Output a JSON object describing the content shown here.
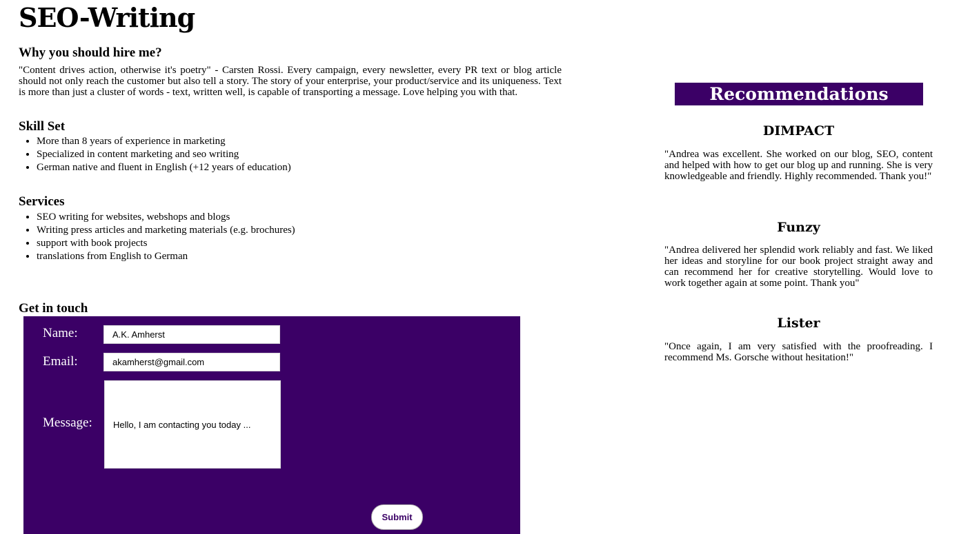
{
  "header": {
    "title": "SEO-Writing"
  },
  "hire": {
    "heading": "Why you should hire me?",
    "text": "\"Content drives action, otherwise it's poetry\" - Carsten Rossi. Every campaign, every newsletter, every PR text or blog article should not only reach the customer but also tell a story. The story of your enterprise, your product/service and its uniqueness. Text is more than just a cluster of words - text, written well, is capable of transporting a message. Love helping you with that."
  },
  "skills": {
    "heading": "Skill Set",
    "items": [
      "More than 8 years of experience in marketing",
      "Specialized in content marketing and seo writing",
      "German native and fluent in English (+12 years of education)"
    ]
  },
  "services": {
    "heading": "Services",
    "items": [
      "SEO writing for websites, webshops and blogs",
      "Writing press articles and marketing materials (e.g. brochures)",
      "support with book projects",
      "translations from English to German"
    ]
  },
  "contact": {
    "heading": "Get in touch",
    "name_label": "Name:",
    "name_value": "A.K. Amherst",
    "email_label": "Email:",
    "email_value": "akamherst@gmail.com",
    "message_label": "Message:",
    "message_value": "Hello, I am contacting you today ...",
    "submit_label": "Submit"
  },
  "recommendations": {
    "heading": "Recommendations",
    "items": [
      {
        "name": "DIMPACT",
        "text": "\"Andrea was excellent. She worked on our blog, SEO, content and helped with how to get our blog up and running. She is very knowledgeable and friendly. Highly recommended. Thank you!\""
      },
      {
        "name": "Funzy",
        "text": "\"Andrea delivered her splendid work reliably and fast. We liked her ideas and storyline for our book project straight away and can recommend her for creative storytelling. Would love to work together again at some point. Thank you\""
      },
      {
        "name": "Lister",
        "text": "\"Once again, I am very satisfied with the proofreading. I recommend Ms. Gorsche without hesitation!\""
      }
    ]
  },
  "colors": {
    "accent": "#3b0066",
    "background": "#ffffff",
    "text": "#000000"
  }
}
